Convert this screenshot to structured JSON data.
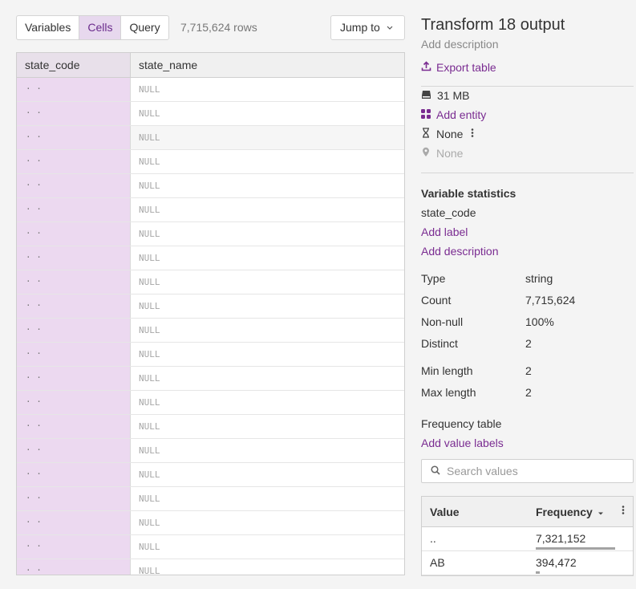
{
  "toolbar": {
    "tabs": [
      {
        "label": "Variables",
        "active": false
      },
      {
        "label": "Cells",
        "active": true
      },
      {
        "label": "Query",
        "active": false
      }
    ],
    "row_count": "7,715,624 rows",
    "jump_label": "Jump to",
    "jump_icon": "chevron-down-icon"
  },
  "table": {
    "columns": [
      "state_code",
      "state_name"
    ],
    "rows": [
      {
        "state_code": "· ·",
        "state_name": "NULL"
      },
      {
        "state_code": "· ·",
        "state_name": "NULL"
      },
      {
        "state_code": "· ·",
        "state_name": "NULL"
      },
      {
        "state_code": "· ·",
        "state_name": "NULL"
      },
      {
        "state_code": "· ·",
        "state_name": "NULL"
      },
      {
        "state_code": "· ·",
        "state_name": "NULL"
      },
      {
        "state_code": "· ·",
        "state_name": "NULL"
      },
      {
        "state_code": "· ·",
        "state_name": "NULL"
      },
      {
        "state_code": "· ·",
        "state_name": "NULL"
      },
      {
        "state_code": "· ·",
        "state_name": "NULL"
      },
      {
        "state_code": "· ·",
        "state_name": "NULL"
      },
      {
        "state_code": "· ·",
        "state_name": "NULL"
      },
      {
        "state_code": "· ·",
        "state_name": "NULL"
      },
      {
        "state_code": "· ·",
        "state_name": "NULL"
      },
      {
        "state_code": "· ·",
        "state_name": "NULL"
      },
      {
        "state_code": "· ·",
        "state_name": "NULL"
      },
      {
        "state_code": "· ·",
        "state_name": "NULL"
      },
      {
        "state_code": "· ·",
        "state_name": "NULL"
      },
      {
        "state_code": "· ·",
        "state_name": "NULL"
      },
      {
        "state_code": "· ·",
        "state_name": "NULL"
      },
      {
        "state_code": "· ·",
        "state_name": "NULL"
      }
    ]
  },
  "panel": {
    "title": "Transform 18 output",
    "subtitle": "Add description",
    "export_label": "Export table",
    "size": "31 MB",
    "add_entity": "Add entity",
    "temporal": "None",
    "spatial": "None",
    "stats_title": "Variable statistics",
    "variable_name": "state_code",
    "add_label": "Add label",
    "add_description": "Add description",
    "stats": {
      "type": {
        "label": "Type",
        "value": "string"
      },
      "count": {
        "label": "Count",
        "value": "7,715,624"
      },
      "nonnull": {
        "label": "Non-null",
        "value": "100%"
      },
      "distinct": {
        "label": "Distinct",
        "value": "2"
      },
      "minlen": {
        "label": "Min length",
        "value": "2"
      },
      "maxlen": {
        "label": "Max length",
        "value": "2"
      }
    },
    "freq_title": "Frequency table",
    "add_value_labels": "Add value labels",
    "search_placeholder": "Search values",
    "freq_table": {
      "col_value": "Value",
      "col_frequency": "Frequency",
      "rows": [
        {
          "value": "..",
          "frequency": "7,321,152",
          "share": 0.949
        },
        {
          "value": "AB",
          "frequency": "394,472",
          "share": 0.051
        }
      ]
    },
    "accent_color": "#7a2c91"
  }
}
